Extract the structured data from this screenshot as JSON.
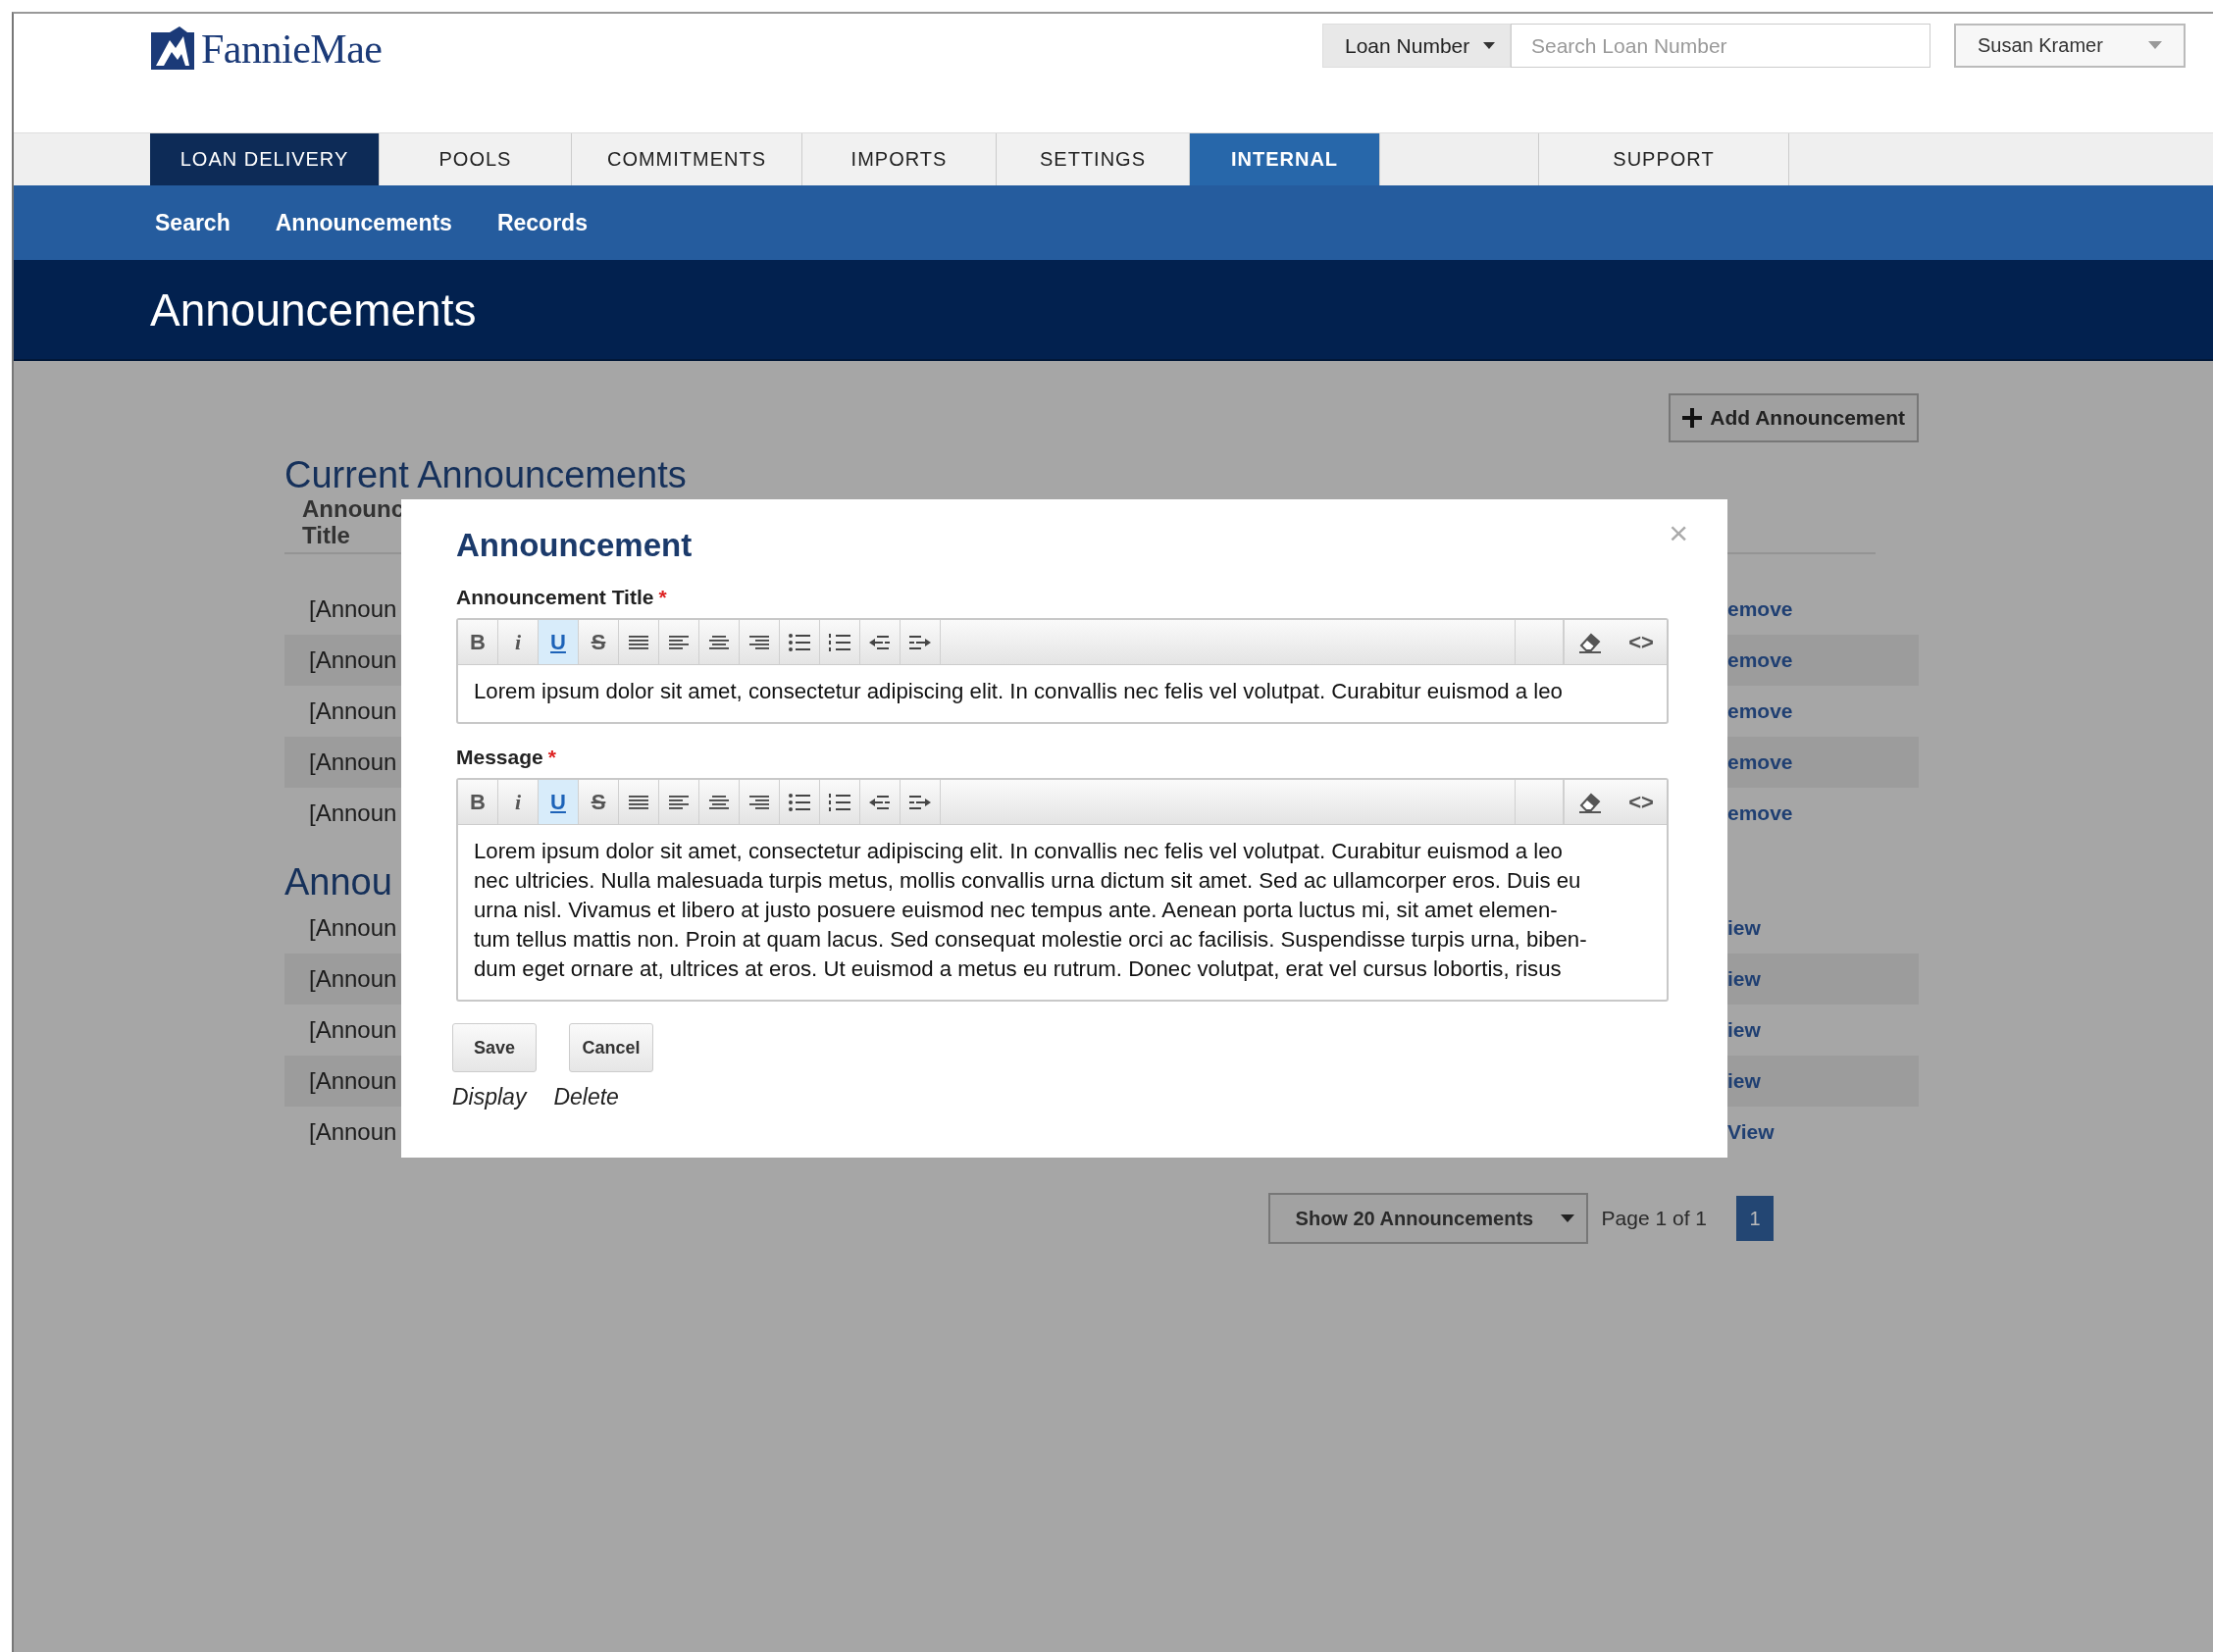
{
  "header": {
    "logo_text": "FannieMae",
    "search": {
      "scope": "Loan Number",
      "placeholder": "Search Loan Number"
    },
    "user": "Susan Kramer"
  },
  "nav_tabs": [
    {
      "label": "LOAN DELIVERY",
      "selected": true,
      "kind": "primary"
    },
    {
      "label": "POOLS",
      "selected": false,
      "kind": "tab"
    },
    {
      "label": "COMMITMENTS",
      "selected": false,
      "kind": "tab"
    },
    {
      "label": "IMPORTS",
      "selected": false,
      "kind": "tab"
    },
    {
      "label": "SETTINGS",
      "selected": false,
      "kind": "tab"
    },
    {
      "label": "INTERNAL",
      "selected": true,
      "kind": "section"
    },
    {
      "label": "SUPPORT",
      "selected": false,
      "kind": "tab"
    }
  ],
  "sub_nav": [
    "Search",
    "Announcements",
    "Records"
  ],
  "page_title": "Announcements",
  "add_button": "Add Announcement",
  "sections": [
    {
      "heading": "Current Announcements",
      "column_header": "Announc Title",
      "rows": [
        {
          "title": "[Announ",
          "action": "emove"
        },
        {
          "title": "[Announ",
          "action": "emove"
        },
        {
          "title": "[Announ",
          "action": "emove"
        },
        {
          "title": "[Announ",
          "action": "emove"
        },
        {
          "title": "[Announ",
          "action": "emove"
        }
      ]
    },
    {
      "heading": "Annou",
      "rows": [
        {
          "title": "[Announ",
          "action": "iew"
        },
        {
          "title": "[Announ",
          "action": "iew"
        },
        {
          "title": "[Announ",
          "action": "iew"
        },
        {
          "title": "[Announ",
          "action": "iew"
        },
        {
          "title": "[Announ",
          "action": "View"
        }
      ]
    }
  ],
  "pagination": {
    "page_size": "Show 20 Announcements",
    "page_info": "Page 1 of 1",
    "pages": [
      {
        "label": "1",
        "selected": true
      }
    ]
  },
  "modal": {
    "title": "Announcement",
    "close": "×",
    "fields": [
      {
        "label": "Announcement Title",
        "required_mark": "*",
        "toolbar": [
          {
            "kind": "bold",
            "label": "B",
            "selected": false
          },
          {
            "kind": "italic",
            "label": "i",
            "selected": false
          },
          {
            "kind": "underline",
            "label": "U",
            "selected": true
          },
          {
            "kind": "strike",
            "label": "S",
            "selected": false
          },
          {
            "kind": "justify",
            "selected": false
          },
          {
            "kind": "align-left",
            "selected": false
          },
          {
            "kind": "align-center",
            "selected": false
          },
          {
            "kind": "align-right",
            "selected": false
          },
          {
            "kind": "bullets",
            "selected": false
          },
          {
            "kind": "numbers",
            "selected": false
          },
          {
            "kind": "outdent",
            "selected": false
          },
          {
            "kind": "indent",
            "selected": false
          }
        ],
        "toolbar_right": [
          {
            "kind": "eraser"
          },
          {
            "kind": "code",
            "label": "<>"
          }
        ],
        "lines": [
          "Lorem ipsum dolor sit amet, consectetur adipiscing elit. In convallis nec felis vel volutpat. Curabitur euismod a leo"
        ]
      },
      {
        "label": "Message",
        "required_mark": "*",
        "toolbar": [
          {
            "kind": "bold",
            "label": "B",
            "selected": false
          },
          {
            "kind": "italic",
            "label": "i",
            "selected": false
          },
          {
            "kind": "underline",
            "label": "U",
            "selected": true
          },
          {
            "kind": "strike",
            "label": "S",
            "selected": false
          },
          {
            "kind": "justify",
            "selected": false
          },
          {
            "kind": "align-left",
            "selected": false
          },
          {
            "kind": "align-center",
            "selected": false
          },
          {
            "kind": "align-right",
            "selected": false
          },
          {
            "kind": "bullets",
            "selected": false
          },
          {
            "kind": "numbers",
            "selected": false
          },
          {
            "kind": "outdent",
            "selected": false
          },
          {
            "kind": "indent",
            "selected": false
          }
        ],
        "toolbar_right": [
          {
            "kind": "eraser"
          },
          {
            "kind": "code",
            "label": "<>"
          }
        ],
        "lines": [
          "Lorem ipsum dolor sit amet, consectetur adipiscing elit. In convallis nec felis vel volutpat. Curabitur euismod a leo",
          "nec ultricies. Nulla malesuada turpis metus, mollis convallis urna dictum sit amet. Sed ac ullamcorper eros. Duis eu",
          "urna nisl. Vivamus et libero at justo posuere euismod nec tempus ante. Aenean porta luctus mi, sit amet elemen-",
          "tum tellus mattis non. Proin at quam lacus. Sed consequat molestie orci ac facilisis. Suspendisse turpis urna, biben-",
          "dum eget ornare at, ultrices at eros. Ut euismod a metus eu rutrum. Donec volutpat, erat vel cursus lobortis, risus"
        ]
      }
    ],
    "buttons": [
      "Save",
      "Cancel"
    ],
    "links": [
      "Display",
      "Delete"
    ]
  }
}
